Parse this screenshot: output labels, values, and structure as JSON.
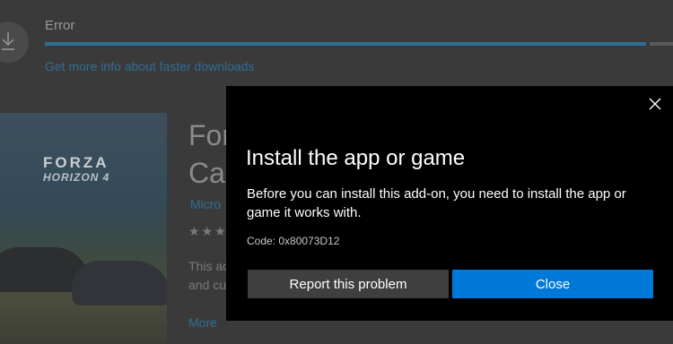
{
  "background": {
    "status_label": "Error",
    "download_icon": "download-arrow-icon",
    "faster_downloads_link": "Get more info about faster downloads",
    "product_art": {
      "brand": "FORZA",
      "subtitle": "HORIZON 4"
    },
    "title_lines": [
      "For",
      "Ca"
    ],
    "publisher": "Micro",
    "rating_stars": "★★★",
    "description_lines": [
      "This ac",
      "and cu"
    ],
    "more_link": "More"
  },
  "dialog": {
    "close_icon": "close-icon",
    "title": "Install the app or game",
    "body": "Before you can install this add-on, you need to install the app or game it works with.",
    "code": "Code: 0x80073D12",
    "report_button": "Report this problem",
    "close_button": "Close"
  },
  "colors": {
    "accent": "#0078d7",
    "dialog_bg": "#000000",
    "secondary_button": "#3f3f3f",
    "link": "#2f6e94"
  }
}
